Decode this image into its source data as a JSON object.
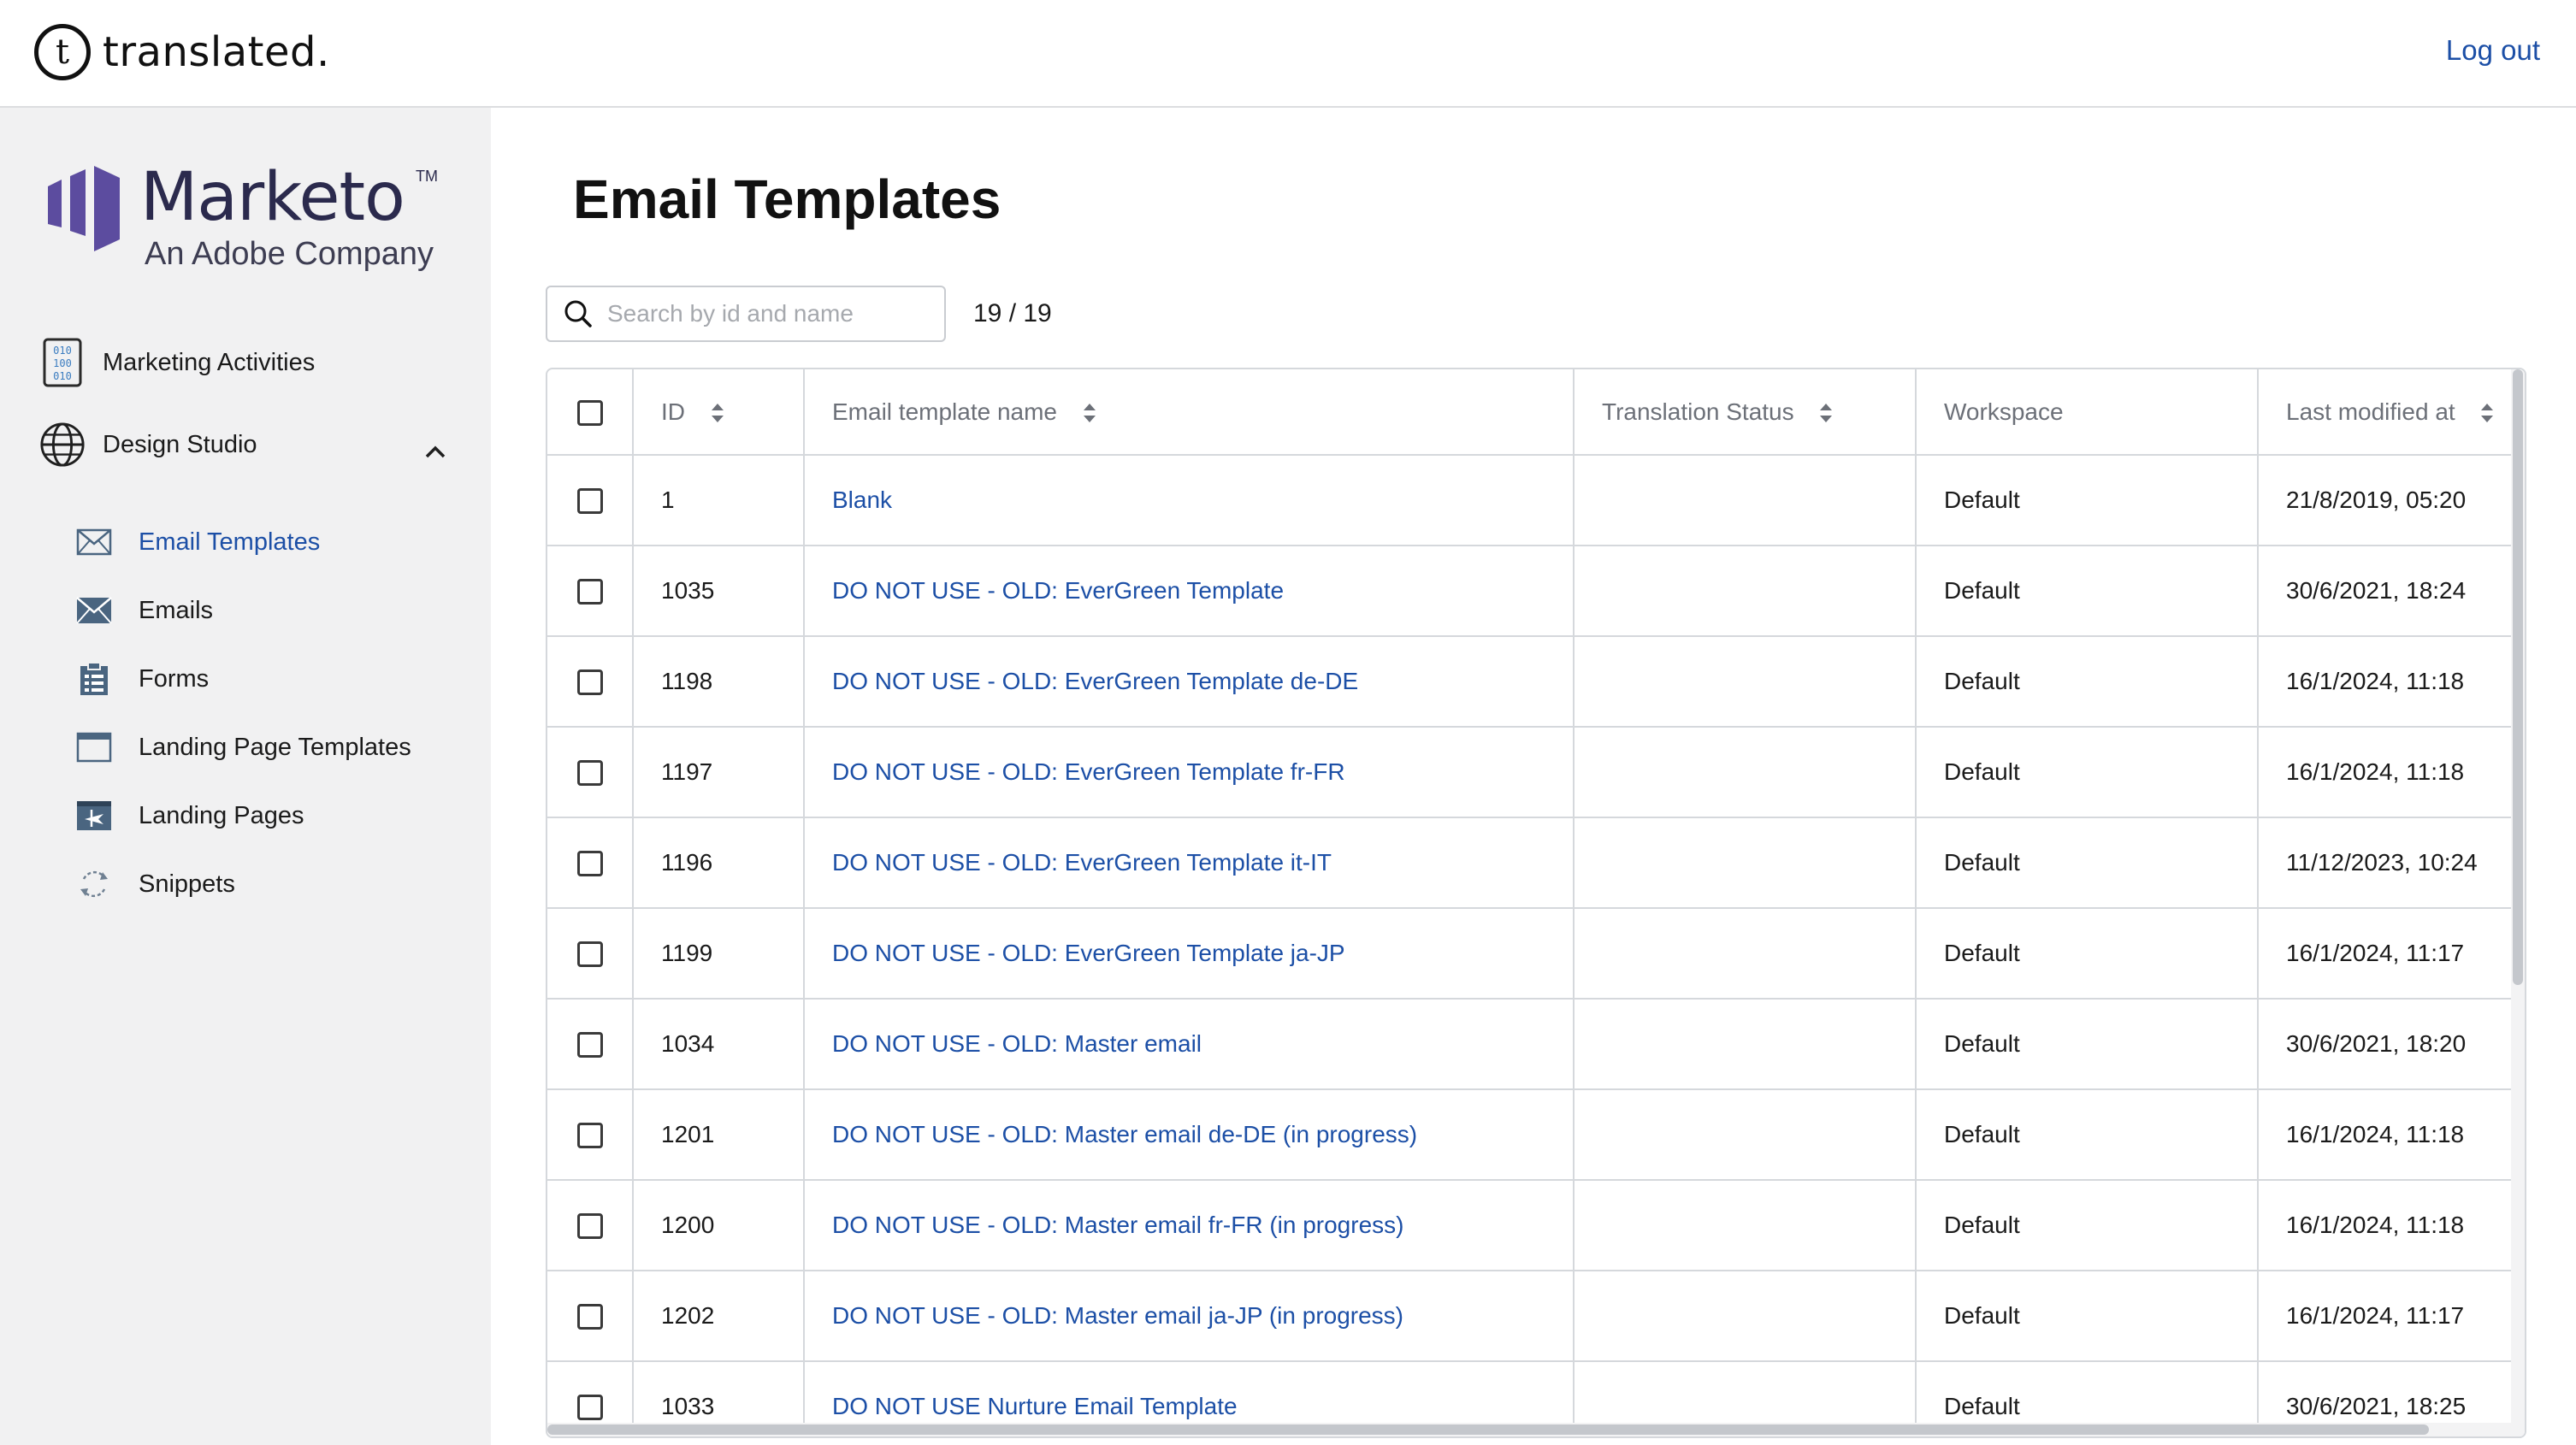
{
  "header": {
    "brand_name": "translated.",
    "logout_label": "Log out"
  },
  "sidebar": {
    "logo": {
      "name": "Marketo",
      "trademark": "TM",
      "subtitle": "An Adobe Company"
    },
    "top_items": [
      {
        "label": "Marketing Activities",
        "icon": "binary-document-icon"
      },
      {
        "label": "Design Studio",
        "icon": "globe-icon",
        "expanded": true
      }
    ],
    "sub_items": [
      {
        "label": "Email Templates",
        "icon": "envelope-outline-icon",
        "active": true
      },
      {
        "label": "Emails",
        "icon": "envelope-icon"
      },
      {
        "label": "Forms",
        "icon": "clipboard-icon"
      },
      {
        "label": "Landing Page Templates",
        "icon": "browser-window-icon"
      },
      {
        "label": "Landing Pages",
        "icon": "landing-page-icon"
      },
      {
        "label": "Snippets",
        "icon": "snippet-refresh-icon"
      }
    ]
  },
  "main": {
    "title": "Email Templates",
    "search": {
      "placeholder": "Search by id and name",
      "value": ""
    },
    "count": "19 / 19",
    "table": {
      "columns": [
        "ID",
        "Email template name",
        "Translation Status",
        "Workspace",
        "Last modified at"
      ],
      "rows": [
        {
          "id": "1",
          "name": "Blank",
          "status": "",
          "workspace": "Default",
          "modified": "21/8/2019, 05:20"
        },
        {
          "id": "1035",
          "name": "DO NOT USE - OLD: EverGreen Template",
          "status": "",
          "workspace": "Default",
          "modified": "30/6/2021, 18:24"
        },
        {
          "id": "1198",
          "name": "DO NOT USE - OLD: EverGreen Template de-DE",
          "status": "",
          "workspace": "Default",
          "modified": "16/1/2024, 11:18"
        },
        {
          "id": "1197",
          "name": "DO NOT USE - OLD: EverGreen Template fr-FR",
          "status": "",
          "workspace": "Default",
          "modified": "16/1/2024, 11:18"
        },
        {
          "id": "1196",
          "name": "DO NOT USE - OLD: EverGreen Template it-IT",
          "status": "",
          "workspace": "Default",
          "modified": "11/12/2023, 10:24"
        },
        {
          "id": "1199",
          "name": "DO NOT USE - OLD: EverGreen Template ja-JP",
          "status": "",
          "workspace": "Default",
          "modified": "16/1/2024, 11:17"
        },
        {
          "id": "1034",
          "name": "DO NOT USE - OLD: Master email",
          "status": "",
          "workspace": "Default",
          "modified": "30/6/2021, 18:20"
        },
        {
          "id": "1201",
          "name": "DO NOT USE - OLD: Master email de-DE (in progress)",
          "status": "",
          "workspace": "Default",
          "modified": "16/1/2024, 11:18"
        },
        {
          "id": "1200",
          "name": "DO NOT USE - OLD: Master email fr-FR (in progress)",
          "status": "",
          "workspace": "Default",
          "modified": "16/1/2024, 11:18"
        },
        {
          "id": "1202",
          "name": "DO NOT USE - OLD: Master email ja-JP (in progress)",
          "status": "",
          "workspace": "Default",
          "modified": "16/1/2024, 11:17"
        },
        {
          "id": "1033",
          "name": "DO NOT USE Nurture Email Template",
          "status": "",
          "workspace": "Default",
          "modified": "30/6/2021, 18:25"
        }
      ]
    }
  },
  "colors": {
    "link": "#1c4fa6",
    "sidebar_bg": "#f1f1f2",
    "marketo_purple": "#5c4c9f",
    "border": "#d5d8dc"
  }
}
